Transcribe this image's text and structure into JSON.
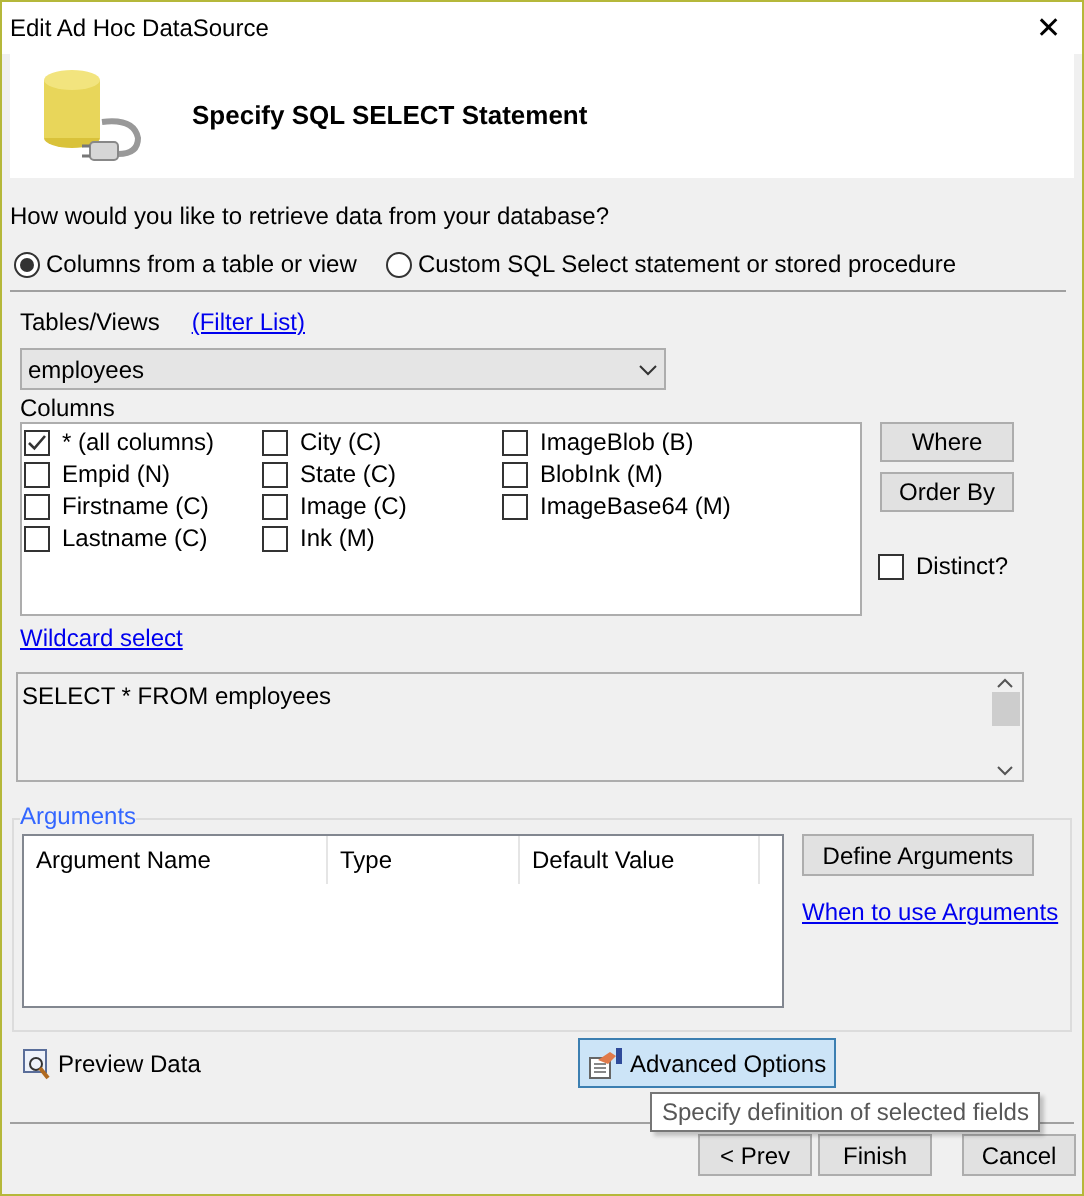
{
  "window": {
    "title": "Edit Ad Hoc DataSource",
    "close": "✕"
  },
  "header": {
    "title": "Specify SQL SELECT Statement"
  },
  "question": "How would you like to retrieve data from your database?",
  "modes": [
    {
      "label": "Columns from a table or view",
      "selected": true
    },
    {
      "label": "Custom SQL Select statement or stored procedure",
      "selected": false
    }
  ],
  "tables": {
    "label": "Tables/Views",
    "filter_link": "(Filter List)",
    "value": "employees"
  },
  "columns": {
    "label": "Columns",
    "items": [
      {
        "label": "* (all columns)",
        "checked": true
      },
      {
        "label": "Empid (N)",
        "checked": false
      },
      {
        "label": "Firstname (C)",
        "checked": false
      },
      {
        "label": "Lastname (C)",
        "checked": false
      },
      {
        "label": "City (C)",
        "checked": false
      },
      {
        "label": "State (C)",
        "checked": false
      },
      {
        "label": "Image (C)",
        "checked": false
      },
      {
        "label": "Ink (M)",
        "checked": false
      },
      {
        "label": "ImageBlob (B)",
        "checked": false
      },
      {
        "label": "BlobInk (M)",
        "checked": false
      },
      {
        "label": "ImageBase64 (M)",
        "checked": false
      }
    ]
  },
  "side_buttons": [
    "Where",
    "Order By"
  ],
  "distinct": {
    "label": "Distinct?",
    "checked": false
  },
  "wildcard_link": "Wildcard select",
  "sql": "SELECT * FROM employees",
  "arguments": {
    "legend": "Arguments",
    "columns": [
      "Argument Name",
      "Type",
      "Default Value"
    ],
    "define_button": "Define Arguments",
    "help_link": "When to use Arguments"
  },
  "preview": "Preview Data",
  "advanced": {
    "label": "Advanced Options",
    "hovered": true,
    "tooltip": "Specify definition of selected fields"
  },
  "footer_buttons": [
    "< Prev",
    "Finish",
    "Cancel"
  ]
}
